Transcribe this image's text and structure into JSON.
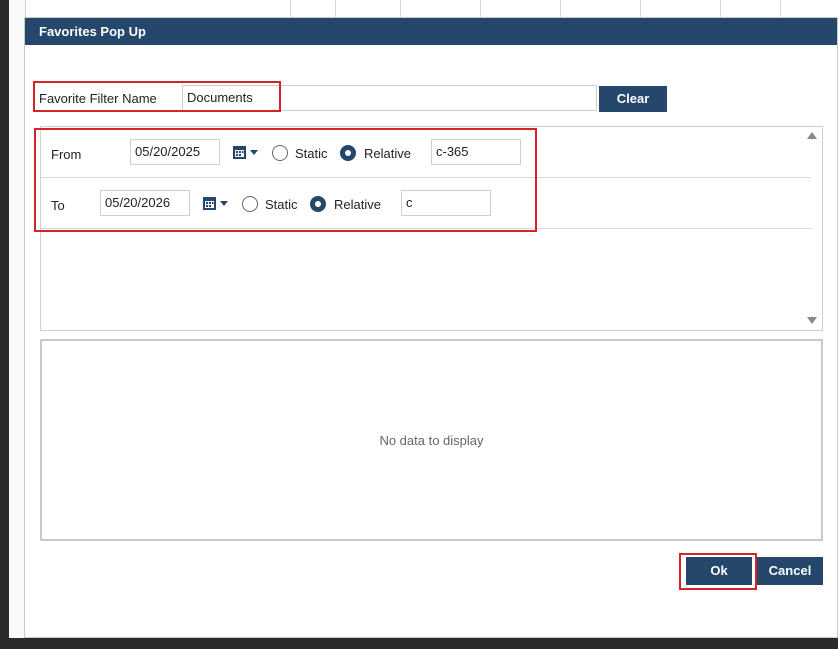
{
  "dialog": {
    "title": "Favorites Pop Up",
    "favorite_filter": {
      "label": "Favorite Filter Name",
      "value": "Documents",
      "clear_label": "Clear"
    },
    "from": {
      "label": "From",
      "date": "05/20/2025",
      "static_label": "Static",
      "relative_label": "Relative",
      "selected": "Relative",
      "relative_value": "c-365"
    },
    "to": {
      "label": "To",
      "date": "05/20/2026",
      "static_label": "Static",
      "relative_label": "Relative",
      "selected": "Relative",
      "relative_value": "c"
    },
    "grid": {
      "empty_text": "No data to display"
    },
    "ok_label": "Ok",
    "cancel_label": "Cancel"
  },
  "colors": {
    "header": "#24476b",
    "button": "#24476b",
    "highlight": "#d6232a"
  },
  "icons": [
    "calendar-icon",
    "caret-down-icon",
    "scroll-up-icon",
    "scroll-down-icon"
  ]
}
